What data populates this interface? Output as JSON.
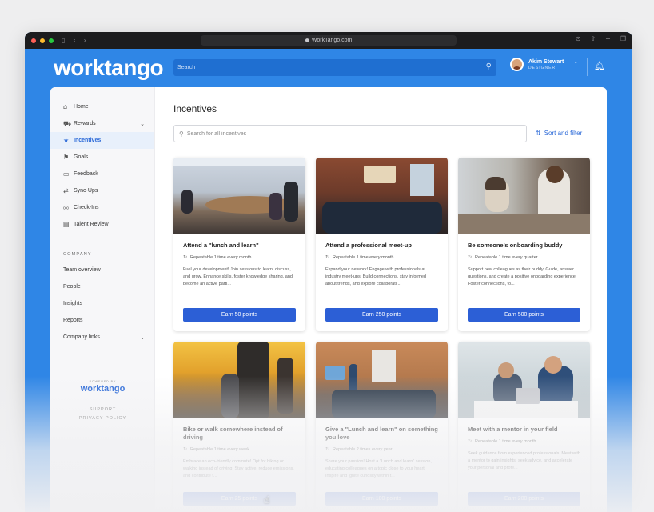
{
  "browser": {
    "url": "WorkTango.com"
  },
  "colors": {
    "brand_blue": "#2f86e6",
    "button_blue": "#2c5fd6",
    "accent_text": "#2c6ad8"
  },
  "header": {
    "logo": "worktango",
    "search_placeholder": "Search",
    "user_name": "Akim Stewart",
    "user_role": "DESIGNER"
  },
  "sidebar": {
    "items": [
      {
        "label": "Home",
        "icon": "home-icon",
        "glyph": "⌂"
      },
      {
        "label": "Rewards",
        "icon": "cart-icon",
        "glyph": "⛟",
        "chevron": true
      },
      {
        "label": "Incentives",
        "icon": "star-icon",
        "glyph": "★",
        "active": true
      },
      {
        "label": "Goals",
        "icon": "goal-icon",
        "glyph": "⚑"
      },
      {
        "label": "Feedback",
        "icon": "feedback-icon",
        "glyph": "▭"
      },
      {
        "label": "Sync-Ups",
        "icon": "sync-icon",
        "glyph": "⇄"
      },
      {
        "label": "Check-Ins",
        "icon": "checkin-icon",
        "glyph": "◎"
      },
      {
        "label": "Talent Review",
        "icon": "clipboard-icon",
        "glyph": "▤"
      }
    ],
    "section_title": "COMPANY",
    "company_items": [
      {
        "label": "Team overview"
      },
      {
        "label": "People"
      },
      {
        "label": "Insights"
      },
      {
        "label": "Reports"
      },
      {
        "label": "Company links",
        "chevron": true
      }
    ],
    "powered_by": "POWERED BY",
    "footer_logo": "worktango",
    "support": "SUPPORT",
    "privacy": "PRIVACY POLICY"
  },
  "main": {
    "title": "Incentives",
    "search_placeholder": "Search for all incentives",
    "sort_filter": "Sort and filter"
  },
  "cards": [
    {
      "title": "Attend a \"lunch and learn\"",
      "repeat": "Repeatable 1 time every month",
      "desc": "Fuel your development! Join sessions to learn, discuss, and grow. Enhance skills, foster knowledge sharing, and become an active parti...",
      "button": "Earn 50 points"
    },
    {
      "title": "Attend a professional meet-up",
      "repeat": "Repeatable 1 time every month",
      "desc": "Expand your network! Engage with professionals at industry meet-ups. Build connections, stay informed about trends, and explore collaborati...",
      "button": "Earn 250 points"
    },
    {
      "title": "Be someone’s onboarding buddy",
      "repeat": "Repeatable 1 time every quarter",
      "desc": "Support new colleagues as their buddy. Guide, answer questions, and create a positive onboarding experience. Foster connections, to...",
      "button": "Earn 500 points"
    },
    {
      "title": "Bike or walk somewhere instead of driving",
      "repeat": "Repeatable 1 time every week",
      "desc": "Embrace an eco-friendly commute! Opt for biking or walking instead of driving. Stay active, reduce emissions, and contribute t...",
      "button": "Earn 25 points"
    },
    {
      "title": "Give a \"Lunch and learn\" on something you love",
      "repeat": "Repeatable 2 times every year",
      "desc": "Share your passion! Host a \"Lunch and learn\" session, educating colleagues on a topic close to your heart. Inspire and ignite curiosity within t...",
      "button": "Earn 100 points"
    },
    {
      "title": "Meet with a mentor in your field",
      "repeat": "Repeatable 1 time every month",
      "desc": "Seek guidance from experienced professionals. Meet with a mentor to gain insights, seek advice, and accelerate your personal and profe...",
      "button": "Earn 200 points"
    }
  ]
}
